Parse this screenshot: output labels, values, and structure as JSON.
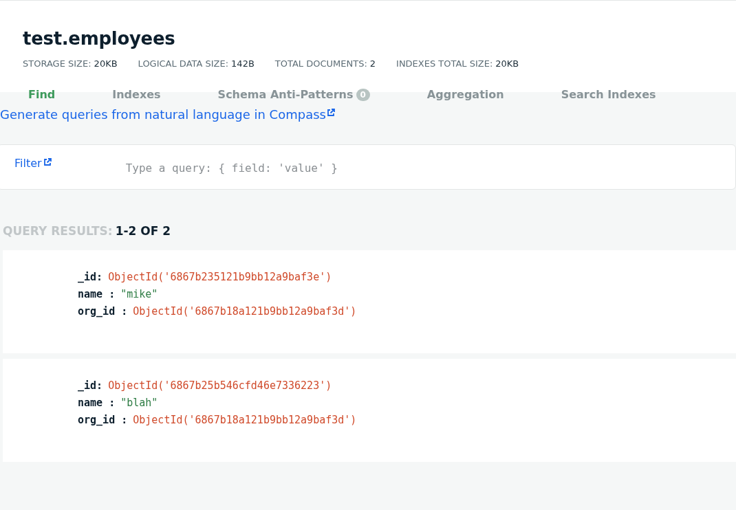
{
  "collection": {
    "title": "test.employees"
  },
  "stats": [
    {
      "label": "STORAGE SIZE:",
      "value": "20KB"
    },
    {
      "label": "LOGICAL DATA SIZE:",
      "value": "142B"
    },
    {
      "label": "TOTAL DOCUMENTS:",
      "value": "2"
    },
    {
      "label": "INDEXES TOTAL SIZE:",
      "value": "20KB"
    }
  ],
  "tabs": [
    {
      "label": "Find",
      "selected": true
    },
    {
      "label": "Indexes",
      "selected": false
    },
    {
      "label": "Schema Anti-Patterns",
      "selected": false,
      "badge": "0"
    },
    {
      "label": "Aggregation",
      "selected": false
    },
    {
      "label": "Search Indexes",
      "selected": false
    }
  ],
  "nl_link": "Generate queries from natural language in Compass",
  "filter": {
    "label": "Filter",
    "placeholder": "Type a query: { field: 'value' }"
  },
  "results": {
    "label": "QUERY RESULTS:",
    "count": "1-2 OF 2"
  },
  "documents": [
    {
      "fields": [
        {
          "key": "_id:",
          "value": "ObjectId('6867b235121b9bb12a9baf3e')",
          "kind": "objectid"
        },
        {
          "key": "name :",
          "value": "\"mike\"",
          "kind": "string"
        },
        {
          "key": "org_id :",
          "value": "ObjectId('6867b18a121b9bb12a9baf3d')",
          "kind": "objectid"
        }
      ]
    },
    {
      "fields": [
        {
          "key": "_id:",
          "value": "ObjectId('6867b25b546cfd46e7336223')",
          "kind": "objectid"
        },
        {
          "key": "name :",
          "value": "\"blah\"",
          "kind": "string"
        },
        {
          "key": "org_id :",
          "value": "ObjectId('6867b18a121b9bb12a9baf3d')",
          "kind": "objectid"
        }
      ]
    }
  ]
}
